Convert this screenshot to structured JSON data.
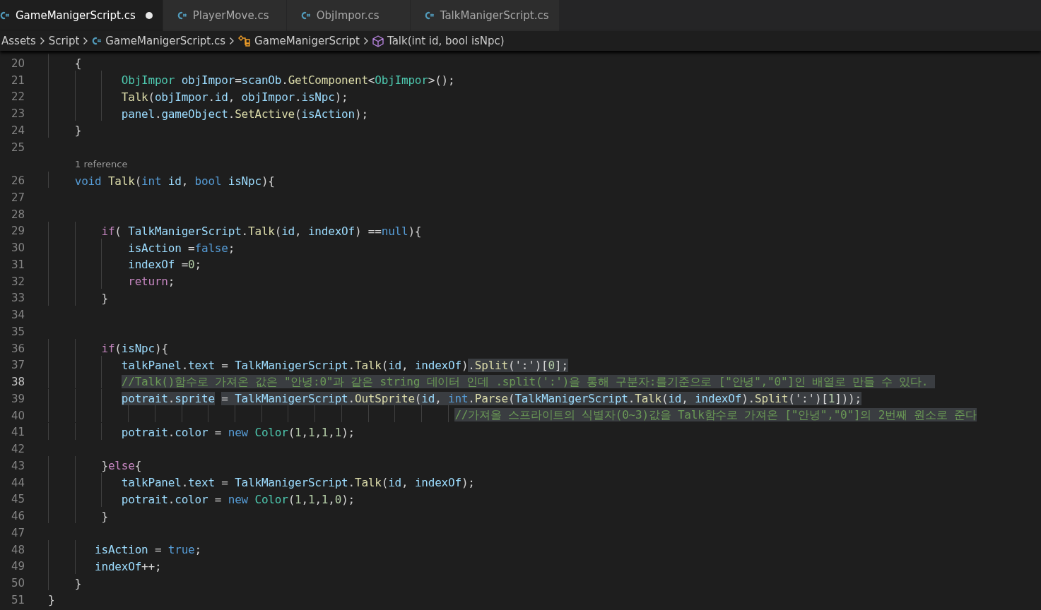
{
  "tabs": [
    {
      "label": "GameManigerScript.cs",
      "selected": true,
      "modified": true
    },
    {
      "label": "PlayerMove.cs",
      "selected": false,
      "modified": false
    },
    {
      "label": "ObjImpor.cs",
      "selected": false,
      "modified": false
    },
    {
      "label": "TalkManigerScript.cs",
      "selected": false,
      "modified": false
    }
  ],
  "breadcrumb": [
    {
      "label": "Assets",
      "kind": "folder"
    },
    {
      "label": "Script",
      "kind": "folder"
    },
    {
      "label": "GameManigerScript.cs",
      "kind": "file"
    },
    {
      "label": "GameManigerScript",
      "kind": "class"
    },
    {
      "label": "Talk(int id, bool isNpc)",
      "kind": "method"
    }
  ],
  "lines": [
    {
      "kind": "code",
      "number": "20",
      "current": false,
      "tokens": [
        {
          "text": "    {",
          "kind": "p"
        }
      ]
    },
    {
      "kind": "code",
      "number": "21",
      "current": false,
      "tokens": [
        {
          "text": "           ObjImpor",
          "kind": "type"
        },
        {
          "text": " objImpor",
          "kind": "var"
        },
        {
          "text": "=",
          "kind": "p"
        },
        {
          "text": "scanOb",
          "kind": "var"
        },
        {
          "text": ".",
          "kind": "p"
        },
        {
          "text": "GetComponent",
          "kind": "fn"
        },
        {
          "text": "<",
          "kind": "p"
        },
        {
          "text": "ObjImpor",
          "kind": "type"
        },
        {
          "text": ">();",
          "kind": "p"
        }
      ]
    },
    {
      "kind": "code",
      "number": "22",
      "current": false,
      "tokens": [
        {
          "text": "           Talk",
          "kind": "fn"
        },
        {
          "text": "(",
          "kind": "p"
        },
        {
          "text": "objImpor",
          "kind": "var"
        },
        {
          "text": ".",
          "kind": "p"
        },
        {
          "text": "id",
          "kind": "var"
        },
        {
          "text": ", ",
          "kind": "p"
        },
        {
          "text": "objImpor",
          "kind": "var"
        },
        {
          "text": ".",
          "kind": "p"
        },
        {
          "text": "isNpc",
          "kind": "var"
        },
        {
          "text": ");",
          "kind": "p"
        }
      ]
    },
    {
      "kind": "code",
      "number": "23",
      "current": false,
      "tokens": [
        {
          "text": "           panel",
          "kind": "var"
        },
        {
          "text": ".",
          "kind": "p"
        },
        {
          "text": "gameObject",
          "kind": "var"
        },
        {
          "text": ".",
          "kind": "p"
        },
        {
          "text": "SetActive",
          "kind": "fn"
        },
        {
          "text": "(",
          "kind": "p"
        },
        {
          "text": "isAction",
          "kind": "var"
        },
        {
          "text": ");",
          "kind": "p"
        }
      ]
    },
    {
      "kind": "code",
      "number": "24",
      "current": false,
      "tokens": [
        {
          "text": "    }",
          "kind": "p"
        }
      ]
    },
    {
      "kind": "code",
      "number": "25",
      "current": false
    },
    {
      "kind": "lens",
      "text": "1 reference"
    },
    {
      "kind": "code",
      "number": "26",
      "current": false,
      "tokens": [
        {
          "text": "    void",
          "kind": "kw"
        },
        {
          "text": " Talk",
          "kind": "fn"
        },
        {
          "text": "(",
          "kind": "p"
        },
        {
          "text": "int",
          "kind": "kw"
        },
        {
          "text": " id",
          "kind": "var"
        },
        {
          "text": ", ",
          "kind": "p"
        },
        {
          "text": "bool",
          "kind": "kw"
        },
        {
          "text": " isNpc",
          "kind": "var"
        },
        {
          "text": "){",
          "kind": "p"
        }
      ]
    },
    {
      "kind": "code",
      "number": "27",
      "current": false
    },
    {
      "kind": "code",
      "number": "28",
      "current": false
    },
    {
      "kind": "code",
      "number": "29",
      "current": false,
      "tokens": [
        {
          "text": "        if",
          "kind": "ctrl"
        },
        {
          "text": "( ",
          "kind": "p"
        },
        {
          "text": "TalkManigerScript",
          "kind": "var"
        },
        {
          "text": ".",
          "kind": "p"
        },
        {
          "text": "Talk",
          "kind": "fn"
        },
        {
          "text": "(",
          "kind": "p"
        },
        {
          "text": "id",
          "kind": "var"
        },
        {
          "text": ", ",
          "kind": "p"
        },
        {
          "text": "indexOf",
          "kind": "var"
        },
        {
          "text": ") ==",
          "kind": "p"
        },
        {
          "text": "null",
          "kind": "kw"
        },
        {
          "text": "){",
          "kind": "p"
        }
      ]
    },
    {
      "kind": "code",
      "number": "30",
      "current": false,
      "tokens": [
        {
          "text": "            isAction",
          "kind": "var"
        },
        {
          "text": " =",
          "kind": "p"
        },
        {
          "text": "false",
          "kind": "kw"
        },
        {
          "text": ";",
          "kind": "p"
        }
      ]
    },
    {
      "kind": "code",
      "number": "31",
      "current": false,
      "tokens": [
        {
          "text": "            indexOf",
          "kind": "var"
        },
        {
          "text": " =",
          "kind": "p"
        },
        {
          "text": "0",
          "kind": "num"
        },
        {
          "text": ";",
          "kind": "p"
        }
      ]
    },
    {
      "kind": "code",
      "number": "32",
      "current": false,
      "tokens": [
        {
          "text": "            return",
          "kind": "ctrl"
        },
        {
          "text": ";",
          "kind": "p"
        }
      ]
    },
    {
      "kind": "code",
      "number": "33",
      "current": false,
      "tokens": [
        {
          "text": "        }",
          "kind": "p"
        }
      ]
    },
    {
      "kind": "code",
      "number": "34",
      "current": false
    },
    {
      "kind": "code",
      "number": "35",
      "current": false
    },
    {
      "kind": "code",
      "number": "36",
      "current": false,
      "tokens": [
        {
          "text": "        if",
          "kind": "ctrl"
        },
        {
          "text": "(",
          "kind": "p"
        },
        {
          "text": "isNpc",
          "kind": "var"
        },
        {
          "text": "){",
          "kind": "p"
        }
      ]
    },
    {
      "kind": "code",
      "number": "37",
      "current": false,
      "tokens": [
        {
          "text": "           talkPanel",
          "kind": "var"
        },
        {
          "text": ".",
          "kind": "p"
        },
        {
          "text": "text",
          "kind": "var"
        },
        {
          "text": " = ",
          "kind": "p"
        },
        {
          "text": "TalkManigerScript",
          "kind": "var"
        },
        {
          "text": ".",
          "kind": "p"
        },
        {
          "text": "Talk",
          "kind": "fn"
        },
        {
          "text": "(",
          "kind": "p"
        },
        {
          "text": "id",
          "kind": "var"
        },
        {
          "text": ", ",
          "kind": "p"
        },
        {
          "text": "indexOf",
          "kind": "var"
        },
        {
          "text": ")",
          "kind": "p"
        },
        {
          "text": ".",
          "kind": "p",
          "highlighted": true
        },
        {
          "text": "Split",
          "kind": "fn",
          "highlighted": true
        },
        {
          "text": "(':')[",
          "kind": "p",
          "highlighted": true
        },
        {
          "text": "0",
          "kind": "num",
          "highlighted": true
        },
        {
          "text": "];",
          "kind": "p",
          "highlighted": true
        }
      ]
    },
    {
      "kind": "code",
      "number": "38",
      "current": true,
      "tokens": [
        {
          "text": "           //Talk()함수로 가져온 값은 \"안녕:0\"과 같은 string 데이터 인데 .split(':')을 통해 구분자:를기준으로 [\"안녕\",\"0\"]인 배열로 만들 수 있다. ",
          "kind": "cm",
          "highlighted": true
        }
      ]
    },
    {
      "kind": "code",
      "number": "39",
      "current": false,
      "tokens": [
        {
          "text": "           potrait",
          "kind": "var",
          "highlighted": true
        },
        {
          "text": ".",
          "kind": "p",
          "highlighted": true
        },
        {
          "text": "sprite",
          "kind": "var",
          "highlighted": true
        },
        {
          "text": " = ",
          "kind": "p",
          "highlighted": true
        },
        {
          "text": "TalkManigerScript",
          "kind": "var",
          "highlighted": true
        },
        {
          "text": ".",
          "kind": "p",
          "highlighted": true
        },
        {
          "text": "OutSprite",
          "kind": "fn",
          "highlighted": true
        },
        {
          "text": "(",
          "kind": "p",
          "highlighted": true
        },
        {
          "text": "id",
          "kind": "var",
          "highlighted": true
        },
        {
          "text": ", ",
          "kind": "p",
          "highlighted": true
        },
        {
          "text": "int",
          "kind": "kw",
          "highlighted": true
        },
        {
          "text": ".",
          "kind": "p",
          "highlighted": true
        },
        {
          "text": "Parse",
          "kind": "fn",
          "highlighted": true
        },
        {
          "text": "(",
          "kind": "p",
          "highlighted": true
        },
        {
          "text": "TalkManigerScript",
          "kind": "var",
          "highlighted": true
        },
        {
          "text": ".",
          "kind": "p",
          "highlighted": true
        },
        {
          "text": "Talk",
          "kind": "fn",
          "highlighted": true
        },
        {
          "text": "(",
          "kind": "p",
          "highlighted": true
        },
        {
          "text": "id",
          "kind": "var",
          "highlighted": true
        },
        {
          "text": ", ",
          "kind": "p",
          "highlighted": true
        },
        {
          "text": "indexOf",
          "kind": "var",
          "highlighted": true
        },
        {
          "text": ").",
          "kind": "p",
          "highlighted": true
        },
        {
          "text": "Split",
          "kind": "fn",
          "highlighted": true
        },
        {
          "text": "(':')[",
          "kind": "p",
          "highlighted": true
        },
        {
          "text": "1",
          "kind": "num",
          "highlighted": true
        },
        {
          "text": "]));",
          "kind": "p",
          "highlighted": true
        }
      ]
    },
    {
      "kind": "code",
      "number": "40",
      "current": false,
      "tokens": [
        {
          "text": "                                                             //가져올 스프라이트의 식별자(0~3)값을 Talk함수로 가져온 [\"안녕\",\"0\"]의 2번째 원소로 준다",
          "kind": "cm",
          "highlighted": true
        }
      ]
    },
    {
      "kind": "code",
      "number": "41",
      "current": false,
      "tokens": [
        {
          "text": "           potrait",
          "kind": "var"
        },
        {
          "text": ".",
          "kind": "p"
        },
        {
          "text": "color",
          "kind": "var"
        },
        {
          "text": " = ",
          "kind": "p"
        },
        {
          "text": "new",
          "kind": "kw"
        },
        {
          "text": " Color",
          "kind": "type"
        },
        {
          "text": "(",
          "kind": "p"
        },
        {
          "text": "1",
          "kind": "num"
        },
        {
          "text": ",",
          "kind": "p"
        },
        {
          "text": "1",
          "kind": "num"
        },
        {
          "text": ",",
          "kind": "p"
        },
        {
          "text": "1",
          "kind": "num"
        },
        {
          "text": ",",
          "kind": "p"
        },
        {
          "text": "1",
          "kind": "num"
        },
        {
          "text": ");",
          "kind": "p"
        }
      ]
    },
    {
      "kind": "code",
      "number": "42",
      "current": false
    },
    {
      "kind": "code",
      "number": "43",
      "current": false,
      "tokens": [
        {
          "text": "        }",
          "kind": "p"
        },
        {
          "text": "else",
          "kind": "ctrl"
        },
        {
          "text": "{",
          "kind": "p"
        }
      ]
    },
    {
      "kind": "code",
      "number": "44",
      "current": false,
      "tokens": [
        {
          "text": "           talkPanel",
          "kind": "var"
        },
        {
          "text": ".",
          "kind": "p"
        },
        {
          "text": "text",
          "kind": "var"
        },
        {
          "text": " = ",
          "kind": "p"
        },
        {
          "text": "TalkManigerScript",
          "kind": "var"
        },
        {
          "text": ".",
          "kind": "p"
        },
        {
          "text": "Talk",
          "kind": "fn"
        },
        {
          "text": "(",
          "kind": "p"
        },
        {
          "text": "id",
          "kind": "var"
        },
        {
          "text": ", ",
          "kind": "p"
        },
        {
          "text": "indexOf",
          "kind": "var"
        },
        {
          "text": ");",
          "kind": "p"
        }
      ]
    },
    {
      "kind": "code",
      "number": "45",
      "current": false,
      "tokens": [
        {
          "text": "           potrait",
          "kind": "var"
        },
        {
          "text": ".",
          "kind": "p"
        },
        {
          "text": "color",
          "kind": "var"
        },
        {
          "text": " = ",
          "kind": "p"
        },
        {
          "text": "new",
          "kind": "kw"
        },
        {
          "text": " Color",
          "kind": "type"
        },
        {
          "text": "(",
          "kind": "p"
        },
        {
          "text": "1",
          "kind": "num"
        },
        {
          "text": ",",
          "kind": "p"
        },
        {
          "text": "1",
          "kind": "num"
        },
        {
          "text": ",",
          "kind": "p"
        },
        {
          "text": "1",
          "kind": "num"
        },
        {
          "text": ",",
          "kind": "p"
        },
        {
          "text": "0",
          "kind": "num"
        },
        {
          "text": ");",
          "kind": "p"
        }
      ]
    },
    {
      "kind": "code",
      "number": "46",
      "current": false,
      "tokens": [
        {
          "text": "        }",
          "kind": "p"
        }
      ]
    },
    {
      "kind": "code",
      "number": "47",
      "current": false
    },
    {
      "kind": "code",
      "number": "48",
      "current": false,
      "tokens": [
        {
          "text": "       isAction",
          "kind": "var"
        },
        {
          "text": " = ",
          "kind": "p"
        },
        {
          "text": "true",
          "kind": "kw"
        },
        {
          "text": ";",
          "kind": "p"
        }
      ]
    },
    {
      "kind": "code",
      "number": "49",
      "current": false,
      "tokens": [
        {
          "text": "       indexOf",
          "kind": "var"
        },
        {
          "text": "++;",
          "kind": "p"
        }
      ]
    },
    {
      "kind": "code",
      "number": "50",
      "current": false,
      "tokens": [
        {
          "text": "    }",
          "kind": "p"
        }
      ]
    },
    {
      "kind": "code",
      "number": "51",
      "current": false,
      "tokens": [
        {
          "text": "}",
          "kind": "p"
        }
      ]
    }
  ]
}
